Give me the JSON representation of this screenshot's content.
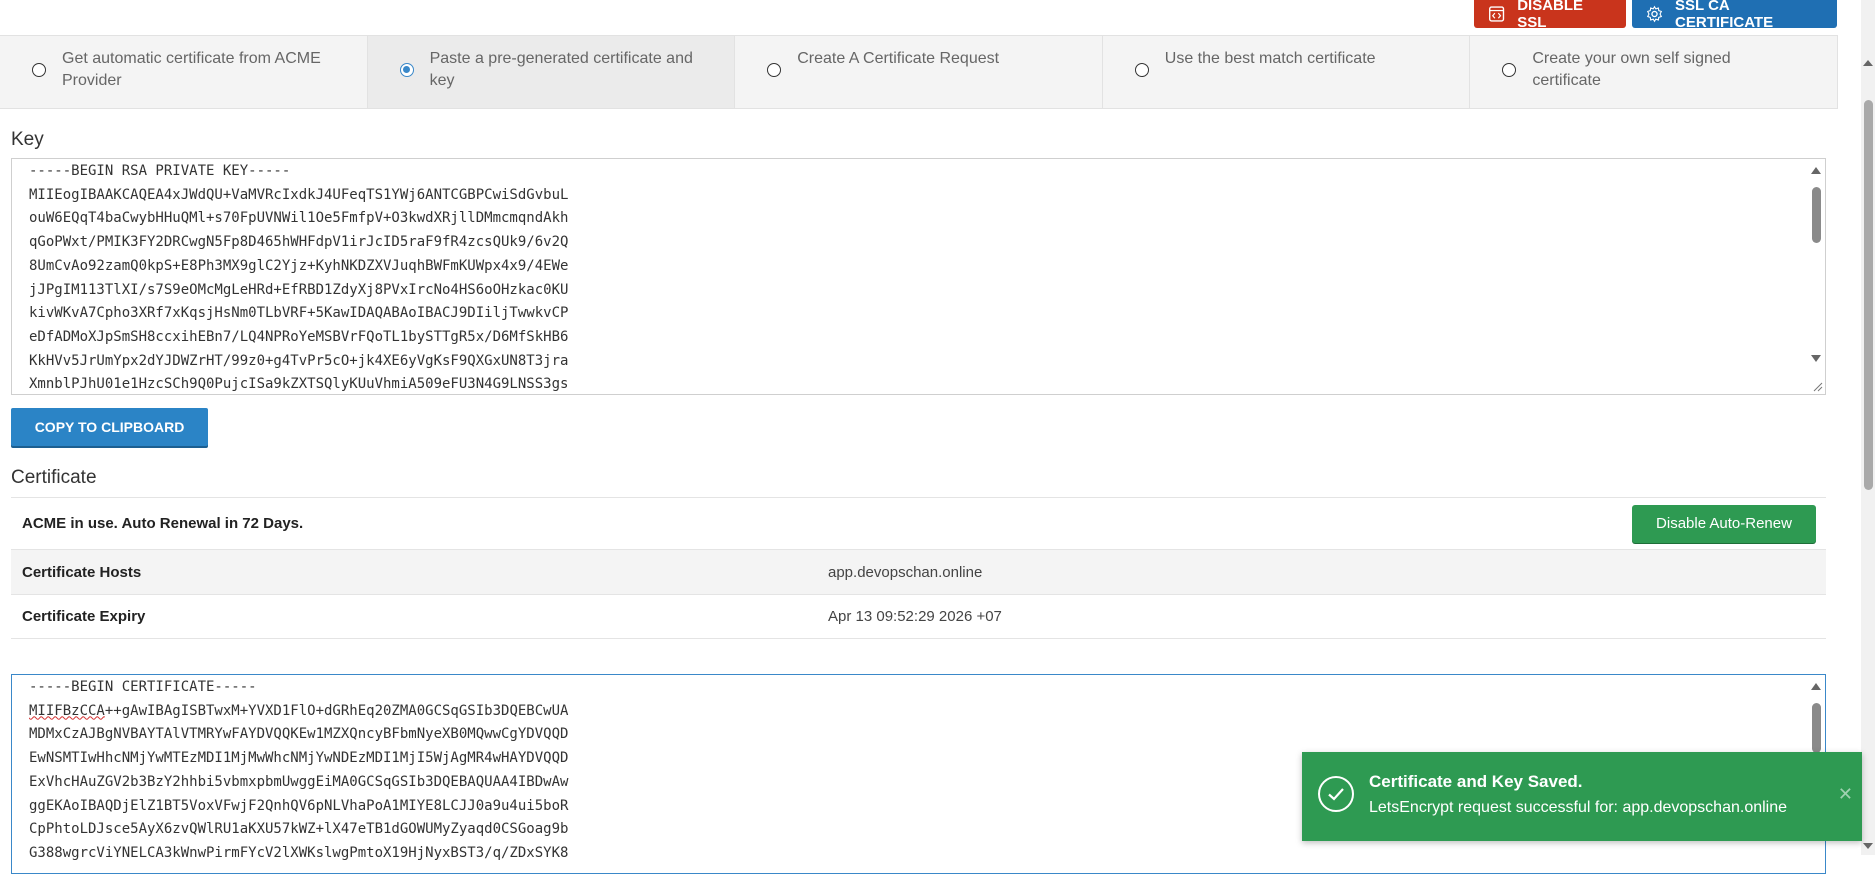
{
  "header": {
    "disable_ssl_label": "DISABLE SSL",
    "ssl_ca_label": "SSL CA CERTIFICATE"
  },
  "tabs": [
    {
      "label": "Get automatic certificate from ACME Provider",
      "checked": false
    },
    {
      "label": "Paste a pre-generated certificate and key",
      "checked": true
    },
    {
      "label": "Create A Certificate Request",
      "checked": false
    },
    {
      "label": "Use the best match certificate",
      "checked": false
    },
    {
      "label": "Create your own self signed certificate",
      "checked": false
    }
  ],
  "key_section": {
    "title": "Key",
    "lines": [
      "-----BEGIN RSA PRIVATE KEY-----",
      "MIIEogIBAAKCAQEA4xJWdQU+VaMVRcIxdkJ4UFeqTS1YWj6ANTCGBPCwiSdGvbuL",
      "ouW6EQqT4baCwybHHuQMl+s70FpUVNWil1Oe5FmfpV+O3kwdXRjllDMmcmqndAkh",
      "qGoPWxt/PMIK3FY2DRCwgN5Fp8D465hWHFdpV1irJcID5raF9fR4zcsQUk9/6v2Q",
      "8UmCvAo92zamQ0kpS+E8Ph3MX9glC2Yjz+KyhNKDZXVJuqhBWFmKUWpx4x9/4EWe",
      "jJPgIM113TlXI/s7S9eOMcMgLeHRd+EfRBD1ZdyXj8PVxIrcNo4HS6oOHzkac0KU",
      "kivWKvA7Cpho3XRf7xKqsjHsNm0TLbVRF+5KawIDAQABAoIBACJ9DIiljTwwkvCP",
      "eDfADMoXJpSmSH8ccxihEBn7/LQ4NPRoYeMSBVrFQoTL1bySTTgR5x/D6MfSkHB6",
      "KkHVv5JrUmYpx2dYJDWZrHT/99z0+g4TvPr5cO+jk4XE6yVgKsF9QXGxUN8T3jra",
      "XmnblPJhU01e1HzcSCh9Q0PujcISa9kZXTSQlyKUuVhmiA509eFU3N4G9LNSS3gs"
    ],
    "copy_label": "COPY TO CLIPBOARD"
  },
  "cert_section": {
    "title": "Certificate",
    "acme_status": "ACME in use. Auto Renewal in 72 Days.",
    "auto_renew_label": "Disable Auto-Renew",
    "hosts_label": "Certificate Hosts",
    "hosts_value": "app.devopschan.online",
    "expiry_label": "Certificate Expiry",
    "expiry_value": "Apr 13 09:52:29 2026 +07",
    "lines": [
      "-----BEGIN CERTIFICATE-----",
      "++gAwIBAgISBTwxM+YVXD1FlO+dGRhEq20ZMA0GCSqGSIb3DQEBCwUA",
      "MDMxCzAJBgNVBAYTAlVTMRYwFAYDVQQKEw1MZXQncyBFbmNyeXB0MQwwCgYDVQQD",
      "EwNSMTIwHhcNMjYwMTEzMDI1MjMwWhcNMjYwNDEzMDI1MjI5WjAgMR4wHAYDVQQD",
      "ExVhcHAuZGV2b3BzY2hhbi5vbmxpbmUwggEiMA0GCSqGSIb3DQEBAQUAA4IBDwAw",
      "ggEKAoIBAQDjElZ1BT5VoxVFwjF2QnhQV6pNLVhaPoA1MIYE8LCJJ0a9u4ui5boR",
      "CpPhtoLDJsce5AyX6zvQWlRU1aKXU57kWZ+lX47eTB1dGOWUMyZyaqd0CSGoag9b",
      "G388wgrcViYNELCA3kWnwPirmFYcV2lXWKslwgPmtoX19HjNyxBST3/q/ZDxSYK8"
    ],
    "first_word": "MIIFBzCCA"
  },
  "toast": {
    "title": "Certificate and Key Saved.",
    "message": "LetsEncrypt request successful for: app.devopschan.online",
    "close_glyph": "✕"
  }
}
